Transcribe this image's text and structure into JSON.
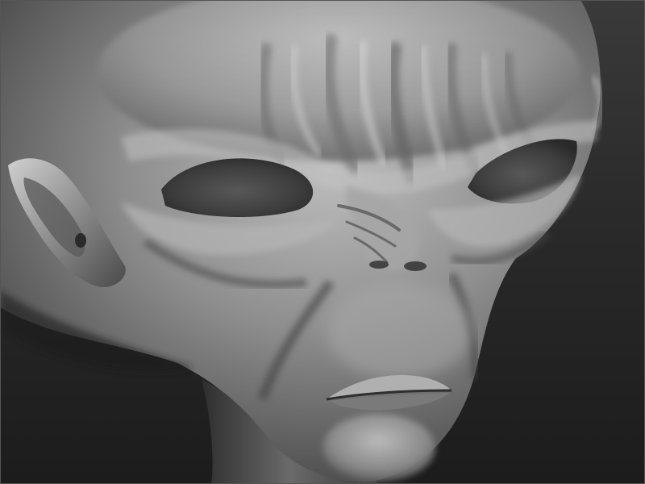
{
  "scene": {
    "subject_icon": "alien-head-sculpt",
    "background_color_top": "#3a3a3a",
    "background_color_bottom": "#1c1c1c",
    "material_base_color": "#8a8a8a",
    "material_highlight_color": "#d6d6d6",
    "material_shadow_color": "#2e2e2e"
  }
}
